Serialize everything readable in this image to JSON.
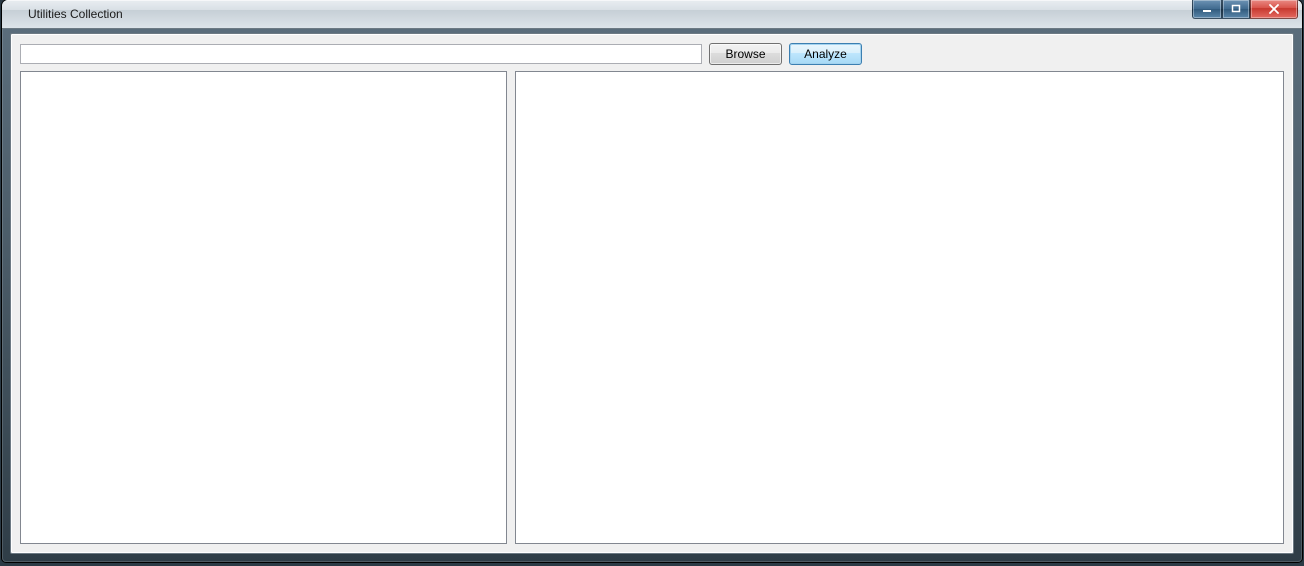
{
  "window": {
    "title": "Utilities Collection"
  },
  "toolbar": {
    "path_value": "",
    "browse_label": "Browse",
    "analyze_label": "Analyze"
  },
  "controls": {
    "minimize_name": "minimize",
    "maximize_name": "maximize",
    "close_name": "close"
  }
}
